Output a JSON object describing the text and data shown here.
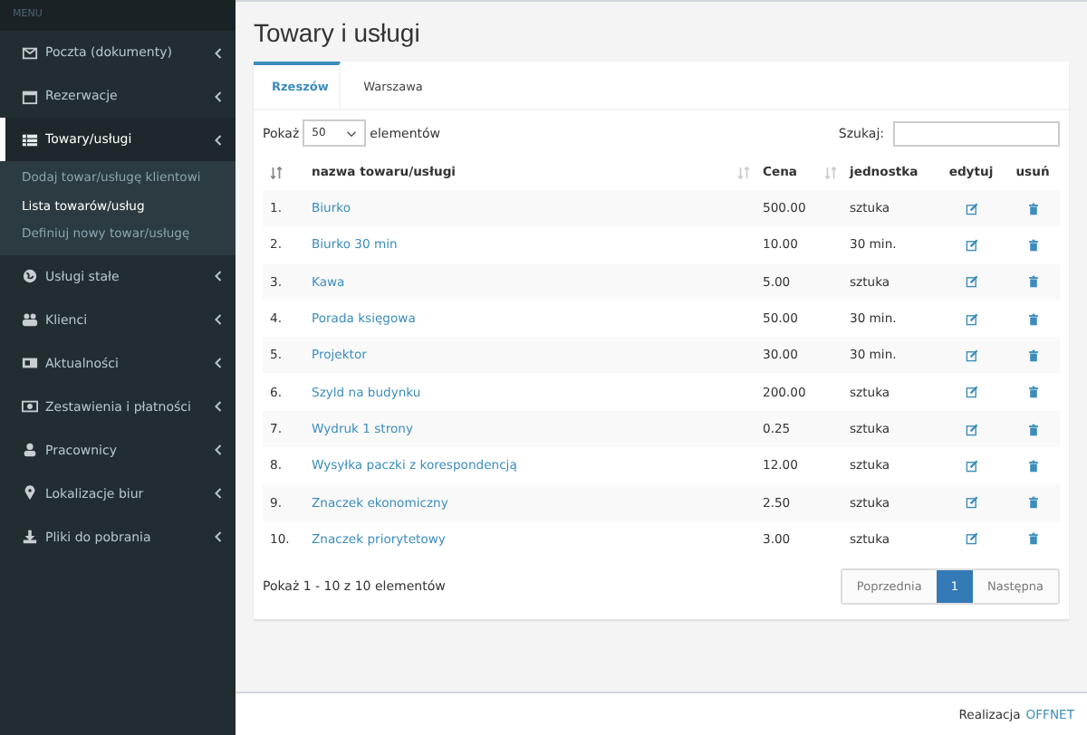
{
  "sidebar": {
    "header": "MENU",
    "items": [
      {
        "label": "Poczta (dokumenty)",
        "expanded": false
      },
      {
        "label": "Rezerwacje",
        "expanded": false
      },
      {
        "label": "Towary/usługi",
        "expanded": true,
        "children": [
          {
            "label": "Dodaj towar/usługę klientowi",
            "selected": false
          },
          {
            "label": "Lista towarów/usług",
            "selected": true
          },
          {
            "label": "Definiuj nowy towar/usługę",
            "selected": false
          }
        ]
      },
      {
        "label": "Usługi stałe",
        "expanded": false
      },
      {
        "label": "Klienci",
        "expanded": false
      },
      {
        "label": "Aktualności",
        "expanded": false
      },
      {
        "label": "Zestawienia i płatności",
        "expanded": false
      },
      {
        "label": "Pracownicy",
        "expanded": false
      },
      {
        "label": "Lokalizacje biur",
        "expanded": false
      },
      {
        "label": "Pliki do pobrania",
        "expanded": false
      }
    ]
  },
  "page_title": "Towary i usługi",
  "tabs": [
    {
      "label": "Rzeszów",
      "selected": true
    },
    {
      "label": "Warszawa",
      "selected": false
    }
  ],
  "length_control": {
    "before": "Pokaż",
    "value": "50",
    "after": "elementów"
  },
  "search": {
    "label": "Szukaj:"
  },
  "table": {
    "columns": [
      {
        "sortable": true,
        "sorted": true
      },
      {
        "label": "nazwa towaru/usługi",
        "sortable": true,
        "sorted": false
      },
      {
        "label": "Cena",
        "sortable": true,
        "sorted": false
      },
      {
        "label": "jednostka",
        "sortable": false
      },
      {
        "label": "edytuj",
        "sortable": false
      },
      {
        "label": "usuń",
        "sortable": false
      }
    ],
    "rows": [
      {
        "no": "1.",
        "name": "Biurko",
        "price": "500.00",
        "unit": "sztuka"
      },
      {
        "no": "2.",
        "name": "Biurko 30 min",
        "price": "10.00",
        "unit": "30 min."
      },
      {
        "no": "3.",
        "name": "Kawa",
        "price": "5.00",
        "unit": "sztuka"
      },
      {
        "no": "4.",
        "name": "Porada księgowa",
        "price": "50.00",
        "unit": "30 min."
      },
      {
        "no": "5.",
        "name": "Projektor",
        "price": "30.00",
        "unit": "30 min."
      },
      {
        "no": "6.",
        "name": "Szyld na budynku",
        "price": "200.00",
        "unit": "sztuka"
      },
      {
        "no": "7.",
        "name": "Wydruk 1 strony",
        "price": "0.25",
        "unit": "sztuka"
      },
      {
        "no": "8.",
        "name": "Wysyłka paczki z korespondencją",
        "price": "12.00",
        "unit": "sztuka"
      },
      {
        "no": "9.",
        "name": "Znaczek ekonomiczny",
        "price": "2.50",
        "unit": "sztuka"
      },
      {
        "no": "10.",
        "name": "Znaczek priorytetowy",
        "price": "3.00",
        "unit": "sztuka"
      }
    ]
  },
  "info": "Pokaż 1 - 10 z 10 elementów",
  "pagination": [
    {
      "label": "Poprzednia",
      "selected": false
    },
    {
      "label": "1",
      "selected": true
    },
    {
      "label": "Następna",
      "selected": false
    }
  ],
  "footer": {
    "text": "Realizacja",
    "link": "OFFNET"
  }
}
